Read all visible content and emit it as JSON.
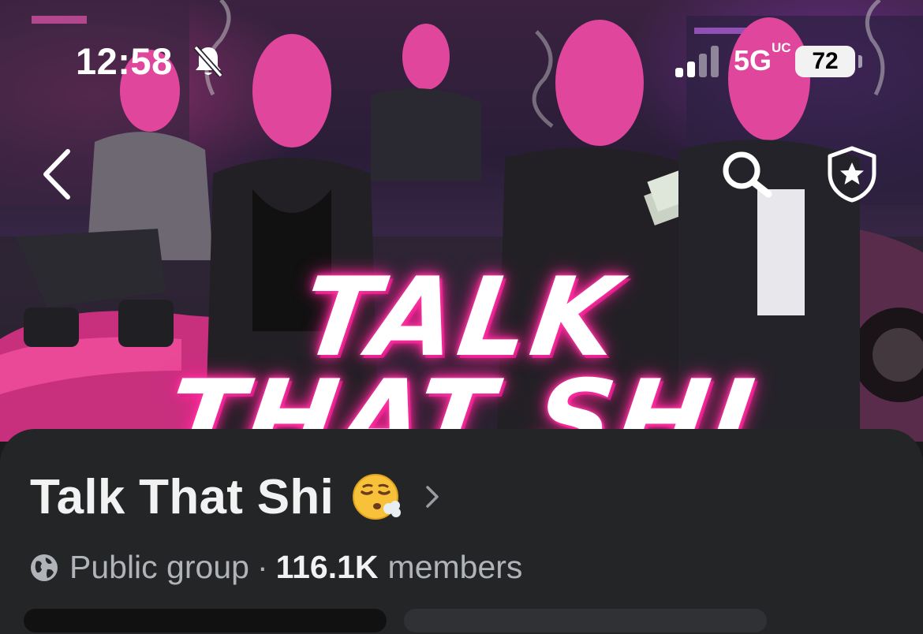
{
  "status_bar": {
    "time": "12:58",
    "network": "5G",
    "network_suffix": "UC",
    "battery": "72"
  },
  "cover": {
    "title_line1": "TALK",
    "title_line2": "THAT SHI",
    "accent_color": "#ff2fa0"
  },
  "nav": {
    "back_icon": "chevron-left-icon",
    "search_icon": "search-icon",
    "shield_icon": "shield-star-icon"
  },
  "group": {
    "name": "Talk That Shi",
    "name_emoji": "😮‍💨",
    "privacy": "Public group",
    "separator": "·",
    "member_count": "116.1K",
    "member_label": "members"
  }
}
